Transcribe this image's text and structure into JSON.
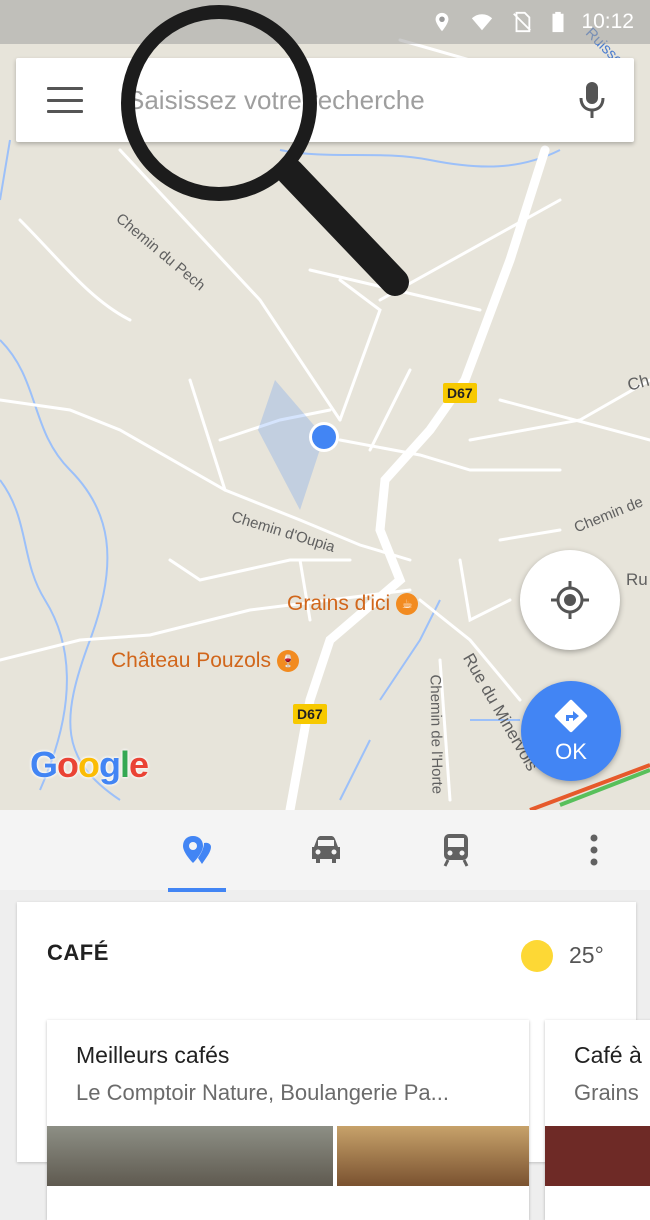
{
  "status_bar": {
    "time": "10:12"
  },
  "search": {
    "placeholder": "Saisissez votre recherche"
  },
  "map": {
    "road_labels": {
      "chemin_pech": "Chemin du Pech",
      "chemin_oupia": "Chemin d'Oupia",
      "chemin_horte": "Chemin de l'Horte",
      "rue_minervois": "Rue du Minervois",
      "chemin_right": "Chemin de",
      "ru_right": "Ru",
      "ch_right": "Ch",
      "ruisseau": "Ruisseau"
    },
    "shields": {
      "d67_top": "D67",
      "d67_bottom": "D67"
    },
    "pois": {
      "grains": "Grains d'ici",
      "chateau": "Château Pouzols"
    },
    "go_button_label": "OK"
  },
  "card": {
    "title": "CAFÉ",
    "temperature": "25°",
    "items": [
      {
        "title": "Meilleurs cafés",
        "description": "Le Comptoir Nature, Boulangerie Pa..."
      },
      {
        "title": "Café à",
        "description": "Grains"
      }
    ]
  },
  "colors": {
    "accent": "#4285f4",
    "poi": "#d1661b",
    "shield": "#f7c900"
  }
}
